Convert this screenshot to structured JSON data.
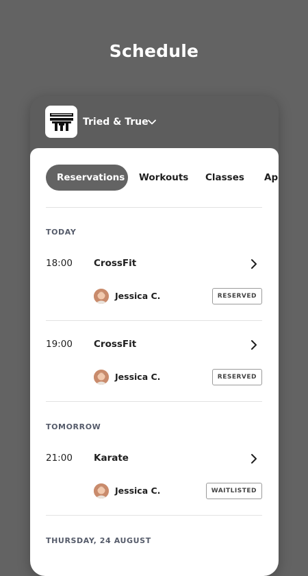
{
  "page_title": "Schedule",
  "gym": {
    "name": "Tried & True",
    "logo_icon": "crossfit-tnt-logo"
  },
  "tabs": [
    {
      "label": "Reservations",
      "active": true
    },
    {
      "label": "Workouts",
      "active": false
    },
    {
      "label": "Classes",
      "active": false
    },
    {
      "label": "App",
      "active": false
    }
  ],
  "sections": [
    {
      "label": "TODAY",
      "items": [
        {
          "time": "18:00",
          "class": "CrossFit",
          "person": "Jessica C.",
          "status": "RESERVED"
        },
        {
          "time": "19:00",
          "class": "CrossFit",
          "person": "Jessica C.",
          "status": "RESERVED"
        }
      ]
    },
    {
      "label": "TOMORROW",
      "items": [
        {
          "time": "21:00",
          "class": "Karate",
          "person": "Jessica C.",
          "status": "WAITLISTED"
        }
      ]
    },
    {
      "label": "THURSDAY, 24 AUGUST",
      "items": []
    }
  ],
  "colors": {
    "background": "#636363",
    "active_tab": "#636363",
    "text": "#1e1e1e",
    "section_label": "#555b6a"
  }
}
